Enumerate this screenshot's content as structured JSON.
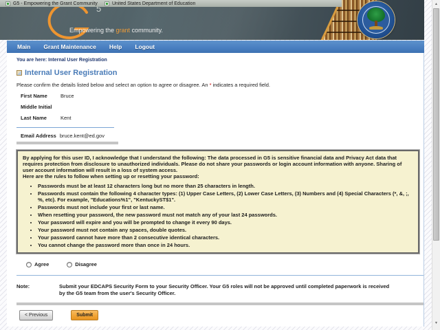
{
  "window": {
    "titles": [
      "G5 - Empowering the Grant Community",
      "United States Department of Education"
    ]
  },
  "banner": {
    "logo_five": "5",
    "tagline_prefix": "Empowering the ",
    "tagline_highlight": "grant",
    "tagline_suffix": " community."
  },
  "nav": {
    "items": [
      {
        "label": "Main"
      },
      {
        "label": "Grant Maintenance"
      },
      {
        "label": "Help"
      },
      {
        "label": "Logout"
      }
    ]
  },
  "breadcrumb": {
    "prefix": "You are here:",
    "current": "Internal User Registration"
  },
  "page": {
    "title": "Internal User Registration",
    "intro_before": "Please confirm the details listed below and select an option to agree or disagree. An ",
    "required_marker": "*",
    "intro_after": " indicates a required field."
  },
  "form": {
    "fields": [
      {
        "label": "First Name",
        "value": "Bruce"
      },
      {
        "label": "Middle Initial",
        "value": ""
      },
      {
        "label": "Last Name",
        "value": "Kent"
      }
    ],
    "email_label": "Email Address",
    "email_value": "bruce.kent@ed.gov"
  },
  "agreement": {
    "paragraph": "By applying for this user ID, I acknowledge that I understand the following: The data processed in G5 is sensitive financial data and Privacy Act data that requires protection from disclosure to unauthorized individuals. Please do not share your passwords or login account information with anyone. Sharing of user account information will result in a loss of system access.",
    "rules_intro": "Here are the rules to follow when setting up or resetting your password:",
    "rules": [
      "Passwords must be at least 12 characters long but no more than 25 characters in length.",
      "Passwords must contain the following 4 character types: (1) Upper Case Letters, (2) Lower Case Letters, (3) Numbers and (4) Special Characters (*, &, ;, %, etc). For example, \"Educations%1\", \"KentuckyST$1\".",
      "Passwords must not include your first or last name.",
      "When resetting your password, the new password must not match any of your last 24 passwords.",
      "Your password will expire and you will be prompted to change it every 90 days.",
      "Your password must not contain any spaces, double quotes.",
      "Your password cannot have more than 2 consecutive identical characters.",
      "You cannot change the password more than once in 24 hours."
    ]
  },
  "options": [
    {
      "label": "Agree"
    },
    {
      "label": "Disagree"
    }
  ],
  "note": {
    "label": "Note:",
    "text": "Submit your EDCAPS Security Form to your Security Officer. Your G5 roles will not be approved until completed paperwork is received by the G5 team from the user's Security Officer."
  },
  "actions": {
    "previous": "< Previous",
    "submit": "Submit"
  },
  "icons": {
    "scroll_up": "▲",
    "scroll_down": "▼"
  },
  "colors": {
    "nav_blue": "#4a80c2",
    "heading_blue": "#4a7cb8",
    "brand_orange": "#ee9530",
    "box_bg": "#f6f2d0",
    "submit_orange": "#f0a232",
    "required_red": "#cc0000",
    "breadcrumb_navy": "#223a72"
  }
}
